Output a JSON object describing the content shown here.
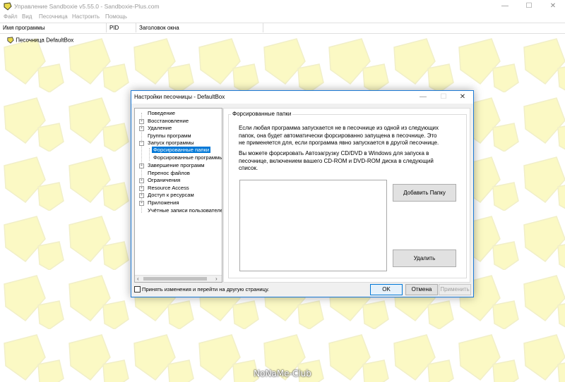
{
  "main_window": {
    "title": "Управление Sandboxie v5.55.0 - Sandboxie-Plus.com",
    "controls": {
      "minimize": "—",
      "maximize": "☐",
      "close": "✕"
    },
    "menu": [
      "Файл",
      "Вид",
      "Песочница",
      "Настроить",
      "Помощь"
    ],
    "columns": [
      "Имя программы",
      "PID",
      "Заголовок окна"
    ],
    "sandbox_name": "Песочница DefaultBox",
    "watermark": "NoNaMe-Club",
    "colors": {
      "accent": "#1c7ad6",
      "selection": "#0078d7",
      "pattern_fill": "#fbf9c4"
    }
  },
  "dialog": {
    "title": "Настройки песочницы - DefaultBox",
    "controls": {
      "minimize": "—",
      "maximize": "☐",
      "close": "✕"
    },
    "tree": [
      {
        "label": "Поведение",
        "expander": false,
        "level": 0
      },
      {
        "label": "Восстановление",
        "expander": true,
        "level": 0
      },
      {
        "label": "Удаление",
        "expander": true,
        "level": 0
      },
      {
        "label": "Группы программ",
        "expander": false,
        "level": 0
      },
      {
        "label": "Запуск программы",
        "expander": "open",
        "level": 0
      },
      {
        "label": "Форсированные папки",
        "expander": false,
        "level": 1,
        "selected": true
      },
      {
        "label": "Форсированные программы",
        "expander": false,
        "level": 1
      },
      {
        "label": "Завершение программ",
        "expander": true,
        "level": 0
      },
      {
        "label": "Перенос файлов",
        "expander": false,
        "level": 0
      },
      {
        "label": "Ограничения",
        "expander": true,
        "level": 0
      },
      {
        "label": "Resource Access",
        "expander": true,
        "level": 0
      },
      {
        "label": "Доступ к ресурсам",
        "expander": true,
        "level": 0
      },
      {
        "label": "Приложения",
        "expander": true,
        "level": 0
      },
      {
        "label": "Учётные записи пользователей",
        "expander": false,
        "level": 0
      }
    ],
    "group_title": "Форсированные папки",
    "paragraph1_lines": [
      "Если любая программа запускается не в песочнице из одной из следующих",
      "папок, она будет автоматически форсированно запущена в песочнице.  Это",
      "не применяется для, если программа явно запускается в другой песочнице."
    ],
    "paragraph2_lines": [
      "Вы можете форсировать Автозагрузку CD/DVD в Windows для запуска в",
      "песочнице, включением вашего CD-ROM и DVD-ROM диска в следующий",
      "список."
    ],
    "add_button": "Добавить Папку",
    "delete_button": "Удалить",
    "apply_checkbox_label": "Принять изменения и перейти на другую страницу.",
    "ok_button": "OK",
    "cancel_button": "Отмена",
    "apply_button": "Применить"
  }
}
